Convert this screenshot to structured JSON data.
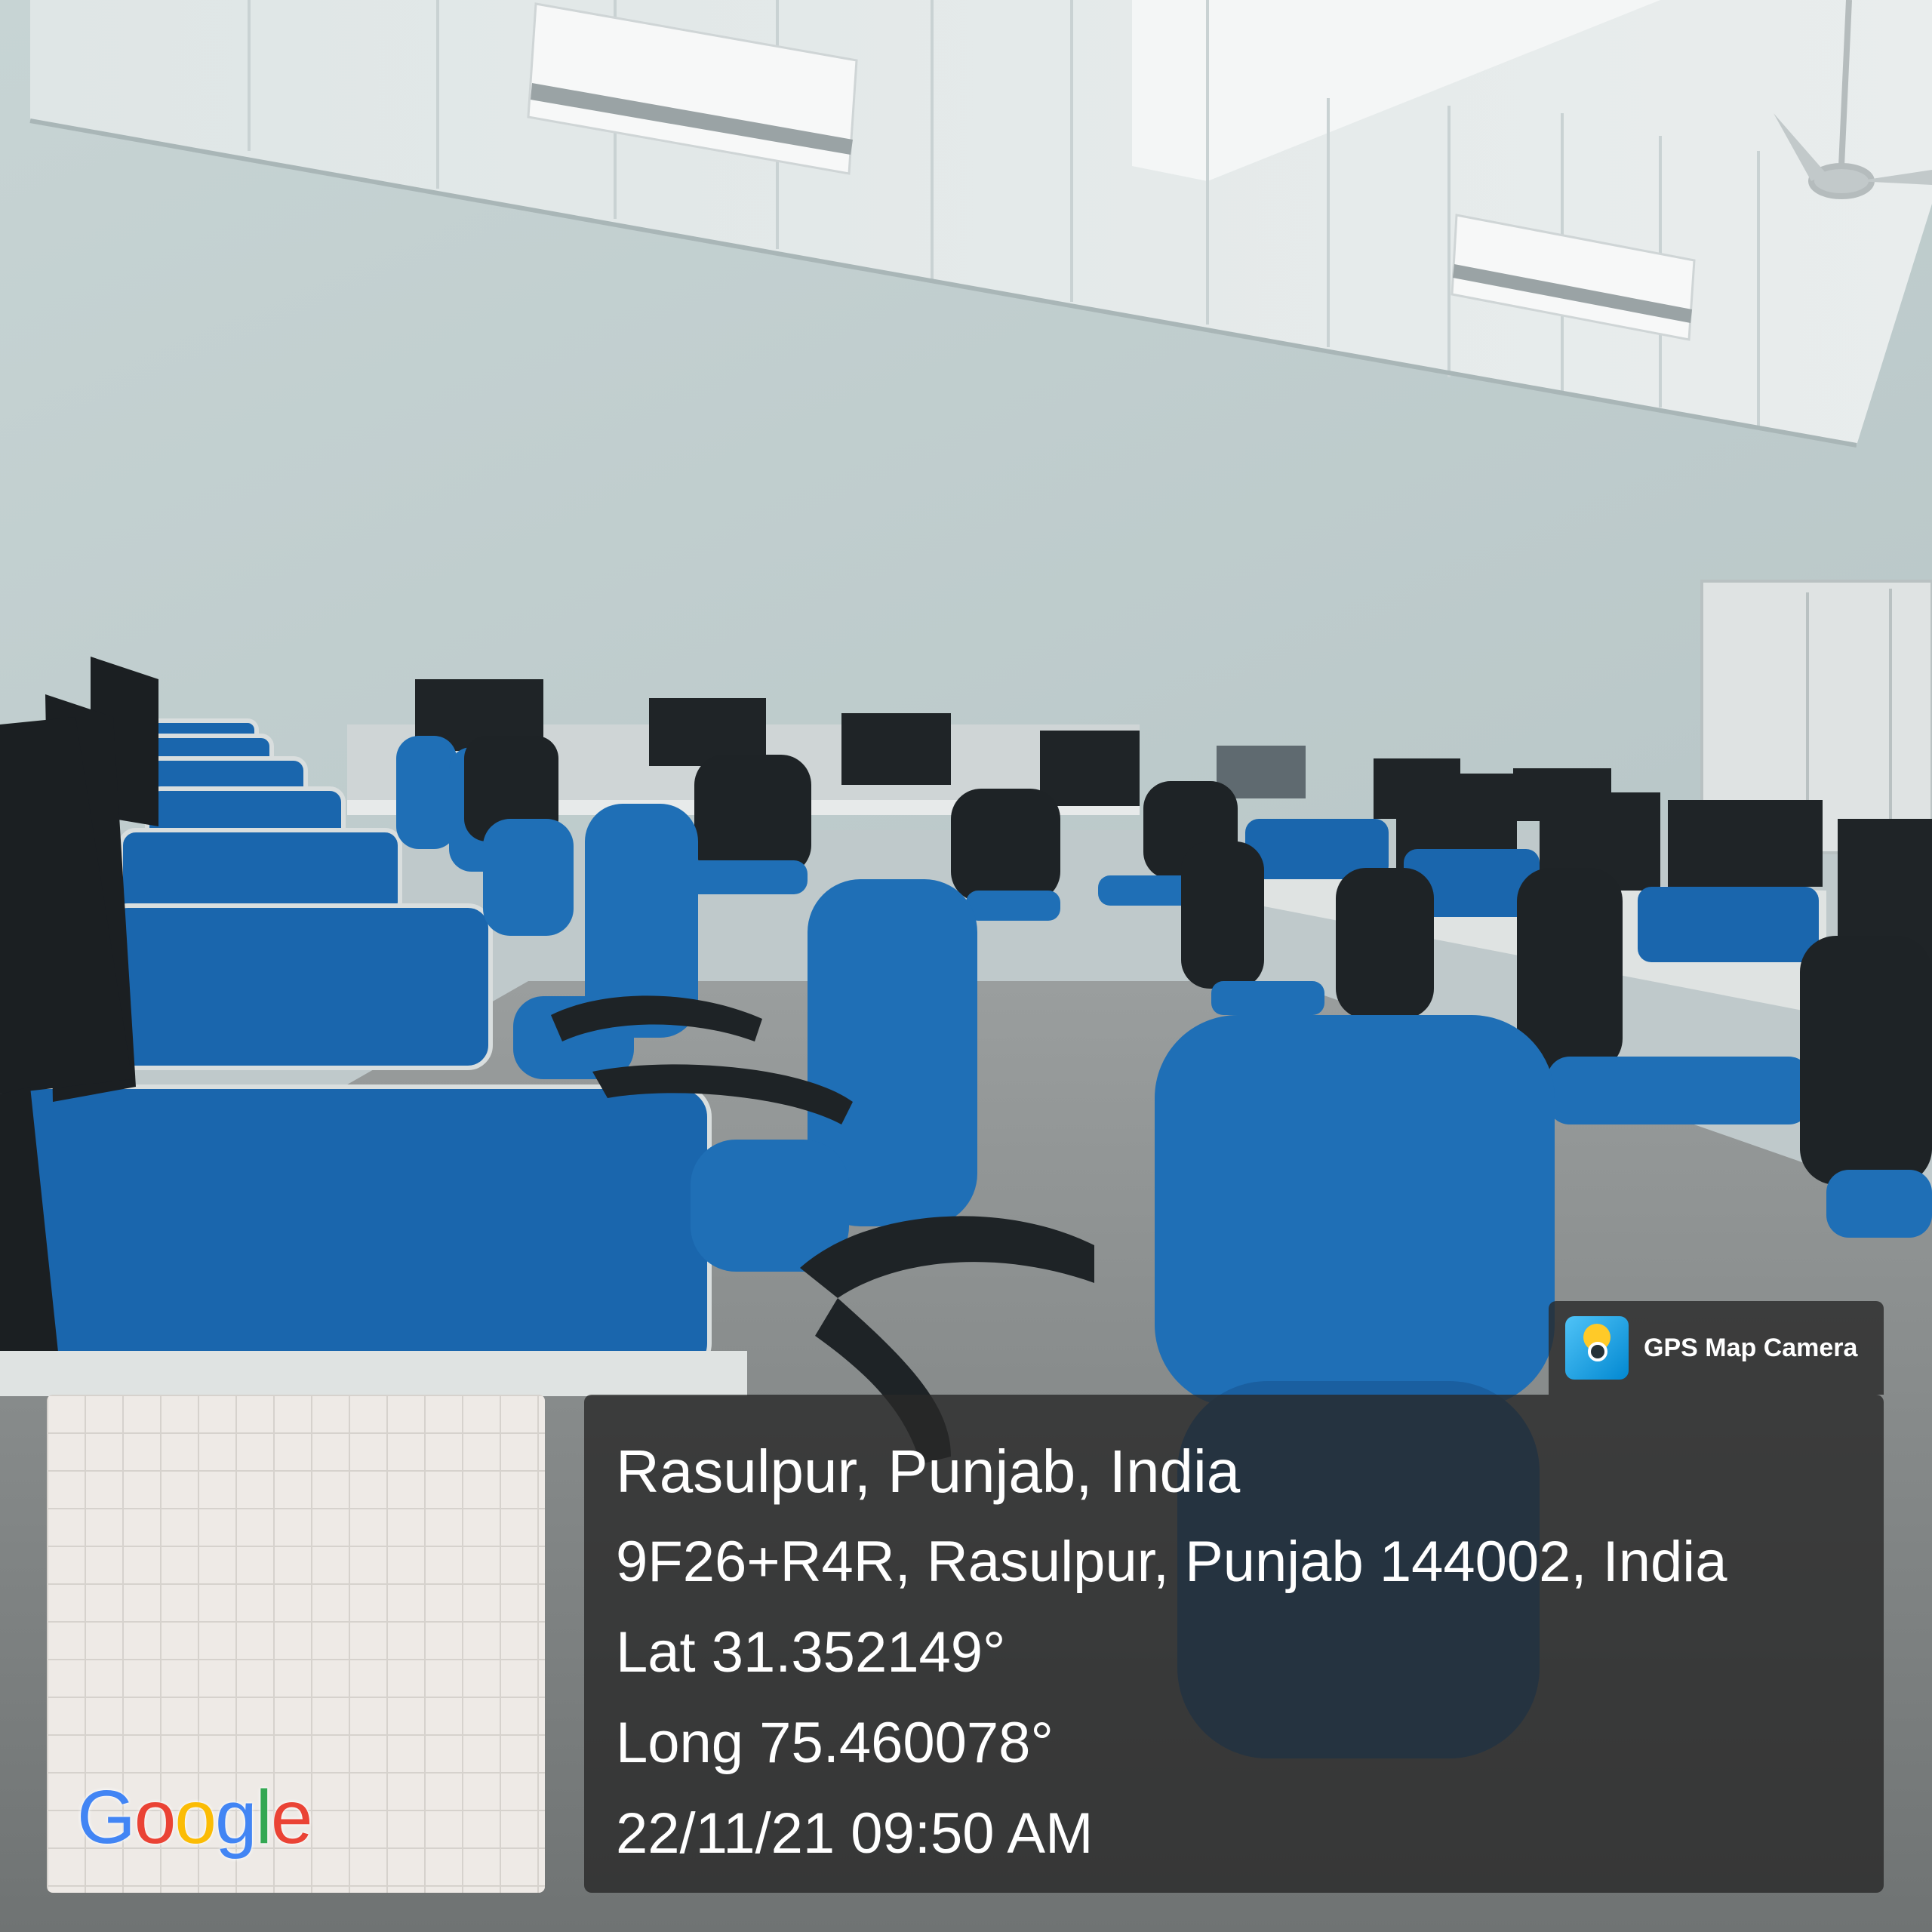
{
  "photo": {
    "scene": "computer-lab",
    "colors": {
      "wall": "#c9d6d6",
      "ceiling-panel": "#e6ebec",
      "floor": "#8d9191",
      "chair-blue": "#1f6fb6",
      "chair-dark": "#1e2326",
      "desk-top": "#dfe3e2",
      "partition-blue": "#1a66ad"
    }
  },
  "overlay": {
    "brand": {
      "icon": "gps-map-camera-icon",
      "label": "GPS Map Camera"
    },
    "map": {
      "logo_text": "Google",
      "logo_colors": [
        "#4285F4",
        "#EA4335",
        "#FBBC05",
        "#4285F4",
        "#34A853",
        "#EA4335"
      ]
    },
    "info": {
      "place": "Rasulpur, Punjab, India",
      "address": "9F26+R4R, Rasulpur, Punjab 144002, India",
      "lat": "Lat 31.352149°",
      "long": "Long 75.460078°",
      "datetime": "22/11/21 09:50 AM"
    }
  }
}
